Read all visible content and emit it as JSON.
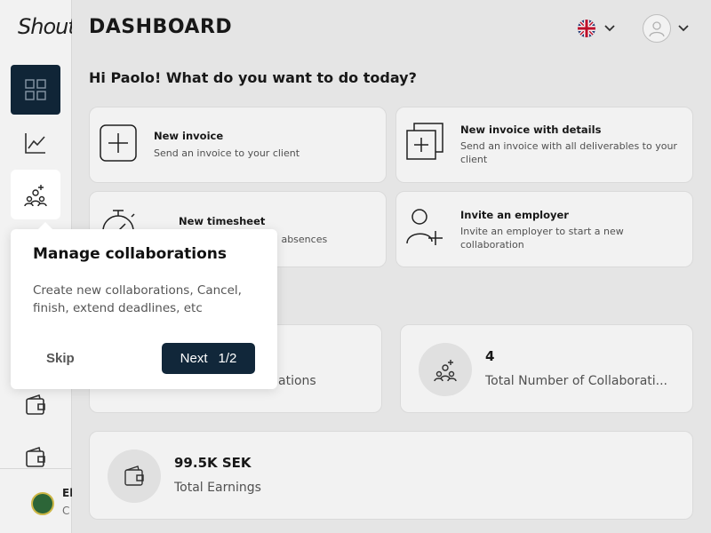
{
  "app": {
    "logo_text": "Shout"
  },
  "header": {
    "title": "DASHBOARD"
  },
  "greeting": "Hi Paolo! What do you want to do today?",
  "sidebar": {
    "items": [
      {
        "name": "dashboard",
        "icon": "grid-icon",
        "active": true
      },
      {
        "name": "analytics",
        "icon": "chart-line-icon",
        "active": false
      },
      {
        "name": "collaborations",
        "icon": "users-plus-icon",
        "active": false
      },
      {
        "name": "wallet-1",
        "icon": "wallet-icon",
        "active": false
      },
      {
        "name": "wallet-2",
        "icon": "wallet-icon",
        "active": false
      }
    ],
    "footer": {
      "name": "El",
      "sub": "C"
    }
  },
  "actions": [
    {
      "title": "New invoice",
      "desc": "Send an invoice to your client",
      "icon": "plus-square-icon"
    },
    {
      "title": "New invoice with details",
      "desc": "Send an invoice with all deliverables to your client",
      "icon": "stacked-plus-icon"
    },
    {
      "title": "New timesheet",
      "desc": "nd absences",
      "icon": "stopwatch-icon"
    },
    {
      "title": "Invite an employer",
      "desc": "Invite an employer to start a new collaboration",
      "icon": "user-plus-icon"
    }
  ],
  "stats": [
    {
      "value": "",
      "label": "ations",
      "icon": "users-icon"
    },
    {
      "value": "4",
      "label": "Total Number of Collaborati...",
      "icon": "users-plus-icon"
    },
    {
      "value": "99.5K SEK",
      "label": "Total Earnings",
      "icon": "wallet-icon"
    }
  ],
  "tour": {
    "title": "Manage collaborations",
    "body": "Create new collaborations, Cancel, finish, extend deadlines, etc",
    "skip_label": "Skip",
    "next_label": "Next",
    "step": "1/2"
  },
  "colors": {
    "accent": "#11273a",
    "background": "#f2f2f2",
    "card": "#ffffff"
  }
}
